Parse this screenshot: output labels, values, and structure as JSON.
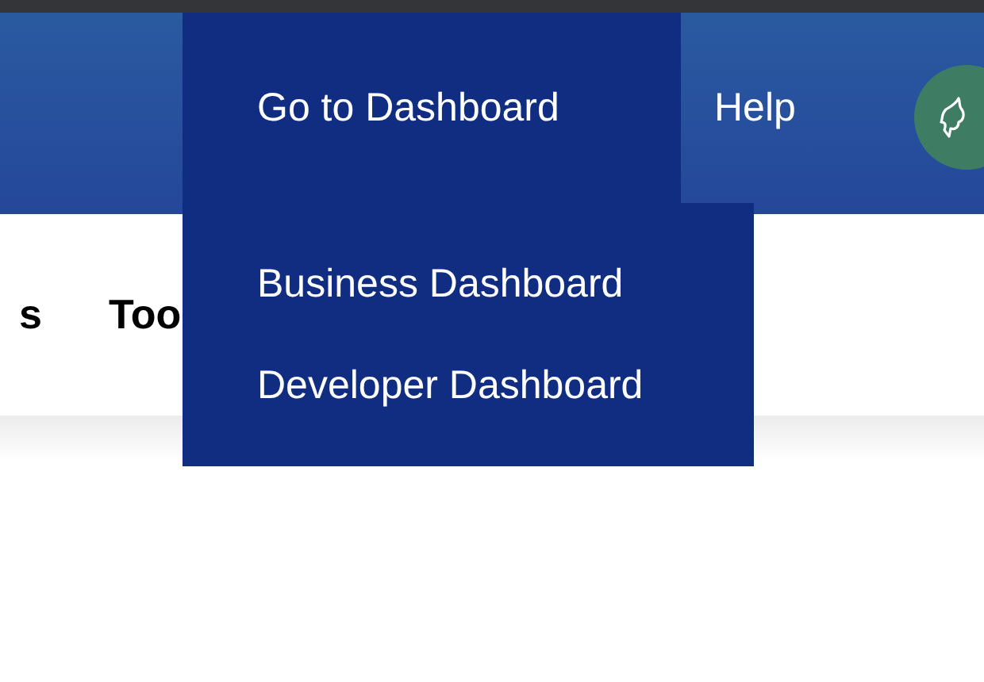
{
  "header": {
    "menu": [
      {
        "label": "Go to Dashboard",
        "kind": "dropdown",
        "expanded": true
      },
      {
        "label": "Help",
        "kind": "link",
        "expanded": false
      }
    ],
    "dropdown": [
      {
        "label": "Business Dashboard"
      },
      {
        "label": "Developer Dashboard"
      }
    ]
  },
  "subnav": [
    {
      "label": "s"
    },
    {
      "label": "Too"
    }
  ]
}
